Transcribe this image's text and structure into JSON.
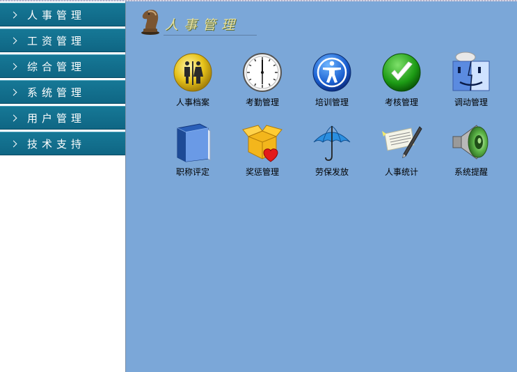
{
  "sidebar": {
    "items": [
      {
        "label": "人事管理"
      },
      {
        "label": "工资管理"
      },
      {
        "label": "综合管理"
      },
      {
        "label": "系统管理"
      },
      {
        "label": "用户管理"
      },
      {
        "label": "技术支持"
      }
    ]
  },
  "header": {
    "title": "人事管理",
    "icon": "chess-knight-icon"
  },
  "modules": [
    {
      "label": "人事档案",
      "icon": "restroom-icon"
    },
    {
      "label": "考勤管理",
      "icon": "clock-icon"
    },
    {
      "label": "培训管理",
      "icon": "accessibility-person-icon"
    },
    {
      "label": "考核管理",
      "icon": "checkmark-icon"
    },
    {
      "label": "调动管理",
      "icon": "finder-face-icon"
    },
    {
      "label": "职称评定",
      "icon": "book-icon"
    },
    {
      "label": "奖惩管理",
      "icon": "gift-box-heart-icon"
    },
    {
      "label": "劳保发放",
      "icon": "umbrella-icon"
    },
    {
      "label": "人事统计",
      "icon": "pen-paper-icon"
    },
    {
      "label": "系统提醒",
      "icon": "speaker-icon"
    }
  ],
  "colors": {
    "background": "#7ba7d8",
    "menu": "#13708e",
    "sidebar": "#ffffff"
  }
}
